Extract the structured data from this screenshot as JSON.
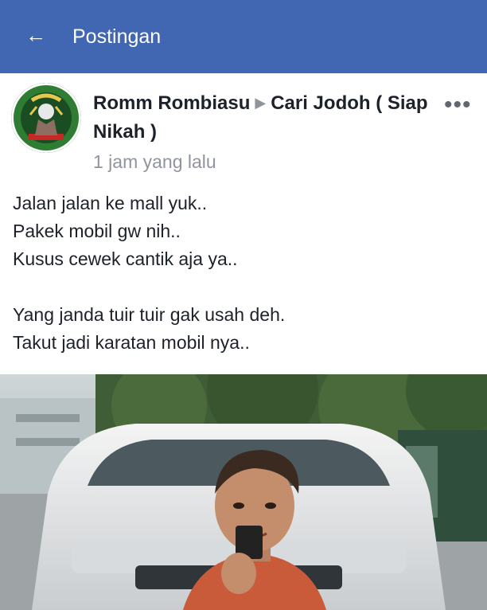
{
  "appbar": {
    "title": "Postingan",
    "back_icon": "arrow-left-icon",
    "color": "#4267b2"
  },
  "post": {
    "author": "Romm Rombiasu",
    "separator_icon": "triangle-right-icon",
    "group": "Cari Jodoh ( Siap Nikah )",
    "time": "1 jam yang lalu",
    "more_icon": "more-horizontal-icon",
    "lines": [
      "Jalan jalan ke mall yuk..",
      "Pakek mobil gw nih..",
      "Kusus cewek cantik aja ya..",
      "Yang janda tuir tuir gak usah deh.",
      "Takut jadi karatan mobil nya.."
    ]
  }
}
